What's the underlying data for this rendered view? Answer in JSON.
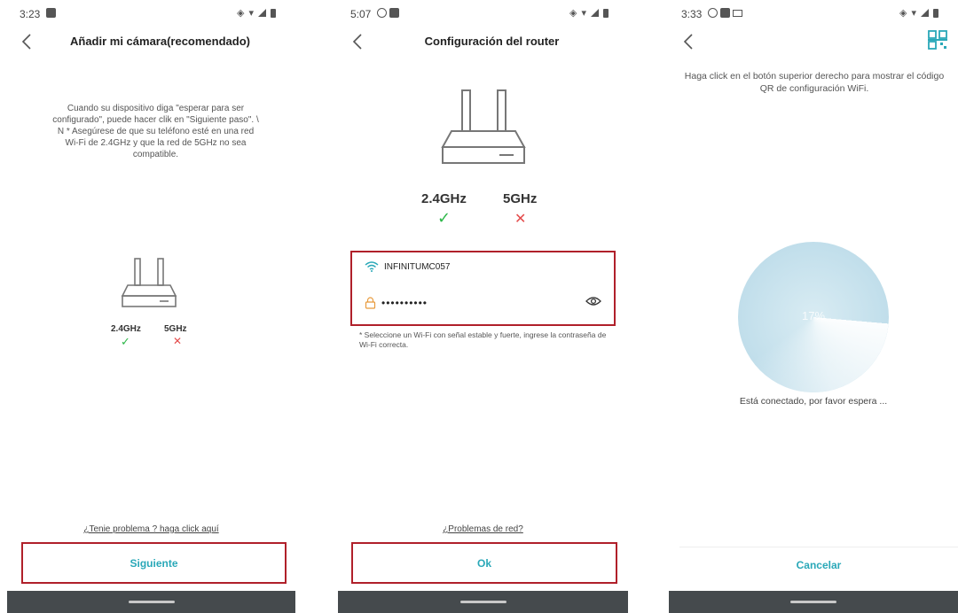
{
  "screen1": {
    "status_time": "3:23",
    "title": "Añadir mi cámara(recomendado)",
    "description": "Cuando su dispositivo diga \"esperar para ser configurado\", puede hacer clik en \"Siguiente paso\". \\ N * Asegúrese de que su teléfono esté en una red Wi-Fi de 2.4GHz y que la red de 5GHz no sea compatible.",
    "freq_24": "2.4GHz",
    "freq_5": "5GHz",
    "help_link": "¿Tenie problema ? haga click aquí",
    "next_button": "Siguiente"
  },
  "screen2": {
    "status_time": "5:07",
    "title": "Configuración del router",
    "freq_24": "2.4GHz",
    "freq_5": "5GHz",
    "wifi_name": "INFINITUMC057",
    "password_masked": "••••••••••",
    "hint": "* Seleccione un Wi-Fi con señal estable y fuerte, ingrese la contraseña de Wi-Fi correcta.",
    "network_problem_link": "¿Problemas de red?",
    "ok_button": "Ok"
  },
  "screen3": {
    "status_time": "3:33",
    "description": "Haga click en el botón superior derecho para mostrar el código QR de configuración WiFi.",
    "progress_label": "17%",
    "status_text": "Está conectado, por favor espera ...",
    "cancel_button": "Cancelar"
  },
  "colors": {
    "accent": "#2aa8b8",
    "highlight_border": "#b0202a",
    "check": "#2eb84a",
    "cross": "#e44c4c",
    "navbar": "#454a4d"
  },
  "icons": [
    "back-arrow-icon",
    "router-icon",
    "check-icon",
    "cross-icon",
    "wifi-icon",
    "lock-icon",
    "eye-icon",
    "qr-code-icon"
  ]
}
